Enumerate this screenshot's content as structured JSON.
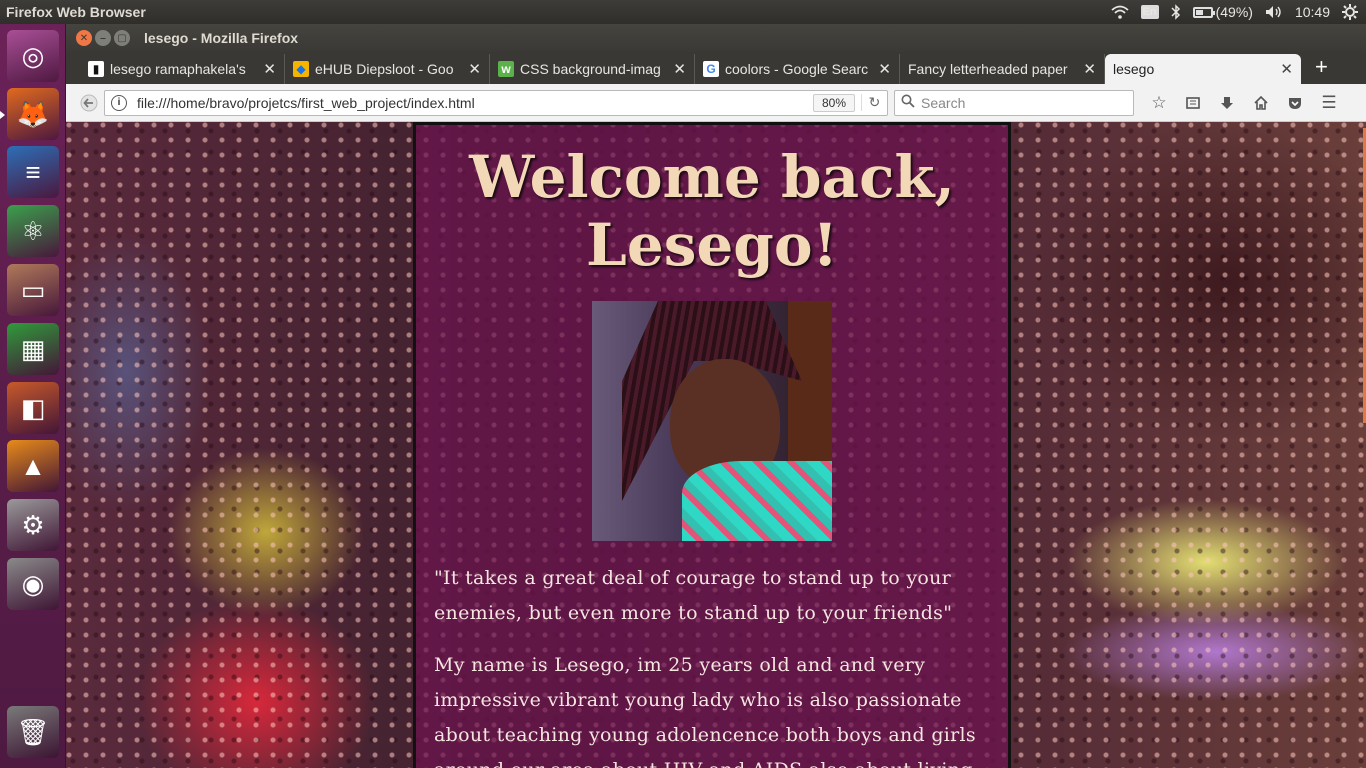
{
  "top_panel": {
    "app_title": "Firefox Web Browser",
    "keyboard": "En",
    "battery": "(49%)",
    "battery_level": 0.49,
    "clock": "10:49",
    "icons": [
      "wifi-icon",
      "keyboard-icon",
      "bluetooth-icon",
      "battery-icon",
      "volume-icon",
      "gear-icon"
    ]
  },
  "launcher": {
    "items": [
      {
        "name": "ubuntu-dash-icon",
        "glyph": "◎",
        "color": "#a94f96"
      },
      {
        "name": "firefox-icon",
        "glyph": "🦊",
        "color": "#e16a1e",
        "active": true
      },
      {
        "name": "libreoffice-writer-icon",
        "glyph": "≡",
        "color": "#2c6fb7"
      },
      {
        "name": "atom-icon",
        "glyph": "⚛",
        "color": "#3aa14c"
      },
      {
        "name": "files-icon",
        "glyph": "▭",
        "color": "#b07a5a"
      },
      {
        "name": "libreoffice-calc-icon",
        "glyph": "▦",
        "color": "#2f9b3a"
      },
      {
        "name": "libreoffice-impress-icon",
        "glyph": "◧",
        "color": "#c85a2a"
      },
      {
        "name": "vlc-icon",
        "glyph": "▲",
        "color": "#e88b1a"
      },
      {
        "name": "system-settings-icon",
        "glyph": "⚙",
        "color": "#9a9a9a"
      },
      {
        "name": "camera-icon",
        "glyph": "◉",
        "color": "#8a8a8a"
      },
      {
        "name": "trash-icon",
        "glyph": "🗑",
        "color": "#7a7a7a"
      }
    ]
  },
  "window": {
    "title": "lesego - Mozilla Firefox"
  },
  "tabs": [
    {
      "label": "lesego ramaphakela's",
      "favicon": "▮",
      "fav_bg": "#ffffff",
      "fav_fg": "#111"
    },
    {
      "label": "eHUB Diepsloot - Goo",
      "favicon": "◆",
      "fav_bg": "#f4b400",
      "fav_fg": "#1a73e8"
    },
    {
      "label": "CSS background-imag",
      "favicon": "w",
      "fav_bg": "#5bb24a",
      "fav_fg": "#ffffff"
    },
    {
      "label": "coolors - Google Searc",
      "favicon": "G",
      "fav_bg": "#ffffff",
      "fav_fg": "#4285f4"
    },
    {
      "label": "Fancy letterheaded paper",
      "favicon": "",
      "fav_bg": "transparent",
      "fav_fg": "#fff"
    },
    {
      "label": "lesego",
      "favicon": "",
      "fav_bg": "transparent",
      "fav_fg": "#222",
      "active": true
    }
  ],
  "navbar": {
    "url": "file:///home/bravo/projetcs/first_web_project/index.html",
    "zoom": "80%",
    "search_placeholder": "Search"
  },
  "page": {
    "heading": "Welcome back, Lesego!",
    "quote": "\"It takes a great deal of courage to stand up to your enemies, but even more to stand up to your friends\"",
    "bio": "My name is Lesego, im 25 years old and and very impressive vibrant young lady who is also passionate about teaching young adolencence both boys and girls around our area about HIV and AIDS also about living"
  }
}
